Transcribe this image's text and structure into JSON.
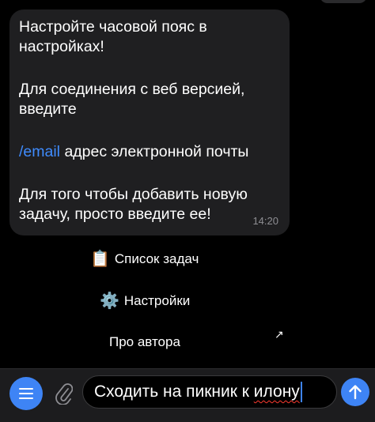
{
  "message": {
    "line1": "Настройте часовой пояс в",
    "line2": "настройках!",
    "line3": "Для соединения с веб версией,",
    "line4": "введите",
    "command": "/email",
    "command_rest": " адрес электронной почты",
    "line6": "Для того чтобы добавить новую",
    "line7": "задачу, просто введите ее!",
    "time": "14:20"
  },
  "keyboard": {
    "tasks_icon": "📋",
    "tasks_label": "Список задач",
    "settings_icon": "⚙️",
    "settings_label": "Настройки",
    "about_label": "Про автора",
    "arrow": "↗"
  },
  "composer": {
    "text_main": "Сходить на пикник к ",
    "text_typo": "илону",
    "menu_icon": "menu-icon",
    "attach_icon": "paperclip-icon",
    "send_icon": "arrow-up-icon",
    "accent_color": "#3e84f5"
  }
}
